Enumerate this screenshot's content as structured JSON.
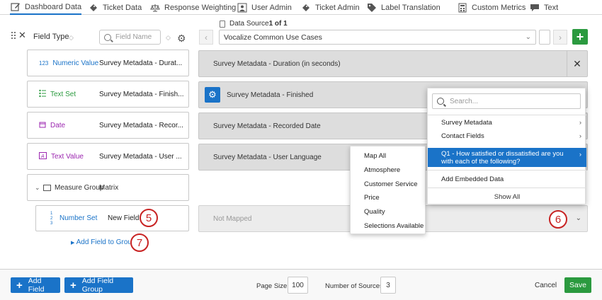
{
  "tabs": [
    {
      "label": "Dashboard Data",
      "icon": "edit-icon"
    },
    {
      "label": "Ticket Data",
      "icon": "ticket-icon"
    },
    {
      "label": "Response Weighting",
      "icon": "scale-icon"
    },
    {
      "label": "User Admin",
      "icon": "user-icon"
    },
    {
      "label": "Ticket Admin",
      "icon": "ticket-icon"
    },
    {
      "label": "Label Translation",
      "icon": "tag-icon"
    },
    {
      "label": "Custom Metrics",
      "icon": "calculator-icon"
    },
    {
      "label": "Text",
      "icon": "text-icon"
    }
  ],
  "field_panel": {
    "header_label": "Field Type",
    "search_placeholder": "Field Name"
  },
  "data_source": {
    "title_prefix": "Data Source ",
    "title_count": "1 of 1",
    "selected": "Vocalize Common Use Cases"
  },
  "fields": [
    {
      "type": "Numeric Value",
      "type_icon": "123",
      "type_color": "#1a73c8",
      "name": "Survey Metadata - Durat...",
      "mapped": "Survey Metadata - Duration (in seconds)"
    },
    {
      "type": "Text Set",
      "type_icon": "list",
      "type_color": "#2b9a3f",
      "name": "Survey Metadata - Finish...",
      "mapped": "Survey Metadata - Finished"
    },
    {
      "type": "Date",
      "type_icon": "calendar",
      "type_color": "#9c27b0",
      "name": "Survey Metadata - Recor...",
      "mapped": "Survey Metadata - Recorded Date"
    },
    {
      "type": "Text Value",
      "type_icon": "A",
      "type_color": "#9c27b0",
      "name": "Survey Metadata - User ...",
      "mapped": "Survey Metadata - User Language"
    }
  ],
  "measure_group": {
    "label": "Measure Group",
    "name": "Matrix"
  },
  "number_set": {
    "type": "Number Set",
    "type_icon": "1 2 3",
    "name": "New Field",
    "mapped": "Not Mapped"
  },
  "add_field_to_group": "Add Field to Group",
  "callouts": [
    "5",
    "6",
    "7"
  ],
  "submenu": {
    "items": [
      "Map All",
      "Atmosphere",
      "Customer Service",
      "Price",
      "Quality",
      "Selections Available"
    ]
  },
  "mainmenu": {
    "search_placeholder": "Search...",
    "items": [
      "Survey Metadata",
      "Contact Fields"
    ],
    "selected": "Q1 - How satisfied or dissatisfied are you with each of the following?",
    "embedded": "Add Embedded Data",
    "show_all": "Show All"
  },
  "footer": {
    "add_field": "Add Field",
    "add_field_group": "Add Field Group",
    "page_size_label": "Page Size:",
    "page_size": "100",
    "sources_label": "Number of Sources:",
    "sources": "3",
    "cancel": "Cancel",
    "save": "Save"
  },
  "colors": {
    "primary": "#1a73c8",
    "success": "#2b9a3f",
    "callout": "#c82323"
  }
}
